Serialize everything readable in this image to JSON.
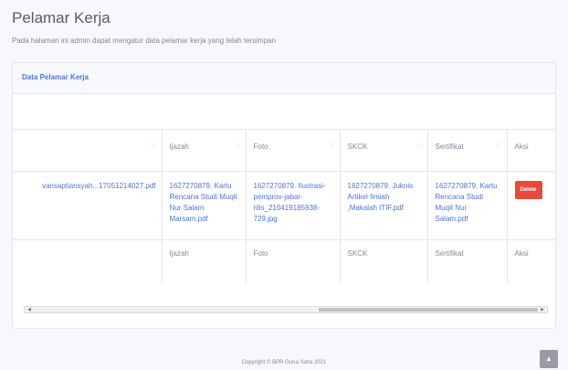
{
  "page": {
    "title": "Pelamar Kerja",
    "description": "Pada halaman ini admin dapat mengatur data pelamar kerja yang telah tersimpan"
  },
  "card": {
    "header": "Data Pelamar Kerja"
  },
  "table": {
    "headers": [
      "",
      "Ijazah",
      "Foto",
      "SKCK",
      "Sertifikat",
      "Aksi"
    ],
    "sort_icon": "sort-arrows-icon",
    "row": {
      "col0": "vansaptiansyah...17051214027.pdf",
      "ijazah": "1627270879. Kartu Rencana Studi Muqit Nur Salam Marsam.pdf",
      "foto": "1627270879. Ilustrasi-pemprov-jabar-rilis_210419185938-729.jpg",
      "skck": "1627270879. Juknis Artikel Ilmiah ,Makalah ITIF.pdf",
      "sertifikat": "1627270879. Kartu Rencana Studi Muqit Nur Salam.pdf",
      "delete_label": "Delete"
    },
    "footer": [
      "",
      "Ijazah",
      "Foto",
      "SKCK",
      "Sertifikat",
      "Aksi"
    ]
  },
  "footer": {
    "copyright": "Copyright © BPR Guna Yatra 2021"
  },
  "colors": {
    "primary": "#4e73df",
    "danger": "#e74a3b",
    "text_muted": "#858796"
  }
}
